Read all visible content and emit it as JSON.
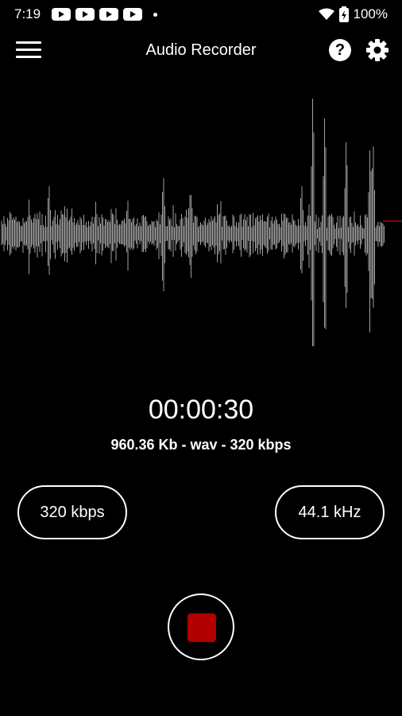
{
  "status_bar": {
    "time": "7:19",
    "battery_percent": "100%",
    "notification_icons": [
      "youtube-icon",
      "youtube-icon",
      "youtube-icon",
      "youtube-icon"
    ]
  },
  "app_bar": {
    "title": "Audio Recorder"
  },
  "recording": {
    "elapsed": "00:00:30",
    "file_info": "960.36 Kb - wav - 320 kbps"
  },
  "controls": {
    "bitrate_label": "320 kbps",
    "sample_rate_label": "44.1 kHz",
    "record_state": "recording"
  },
  "colors": {
    "background": "#000000",
    "waveform": "#a0a0a0",
    "stop_button": "#b00000",
    "playhead": "#c00000"
  }
}
